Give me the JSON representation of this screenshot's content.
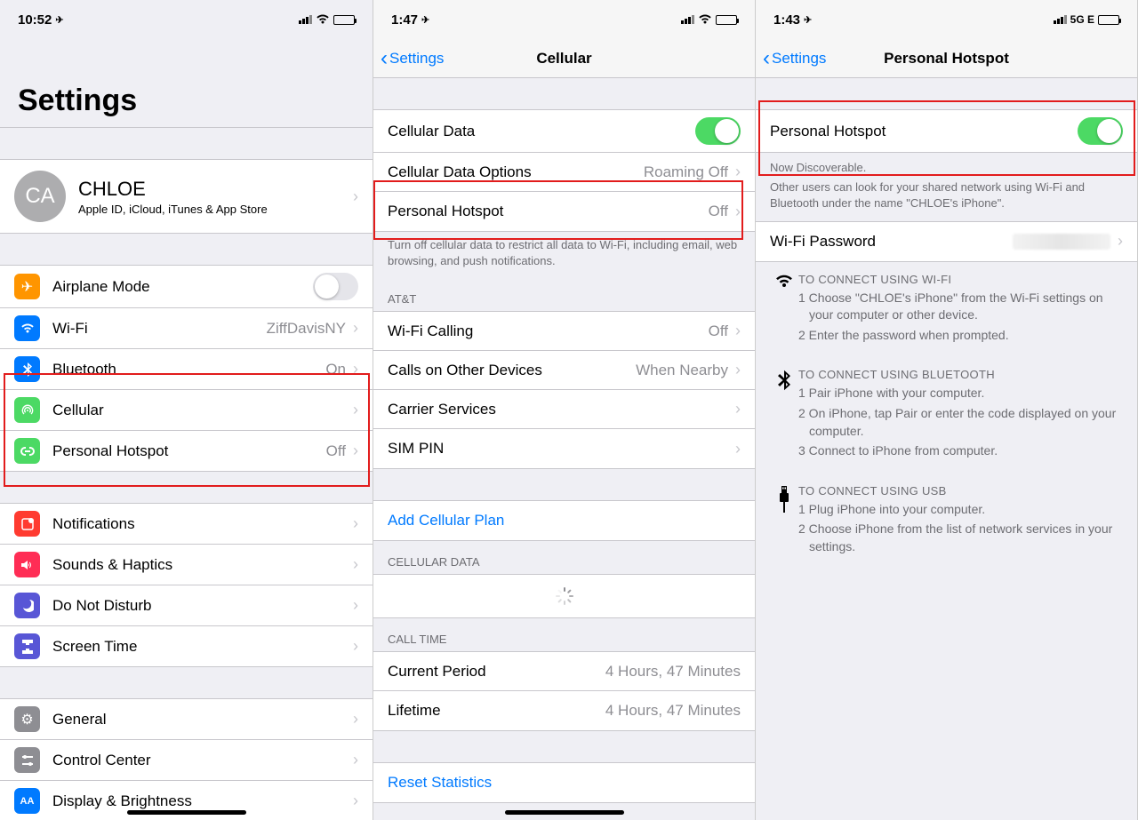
{
  "panel1": {
    "status_time": "10:52",
    "location_arrow": "➤",
    "title": "Settings",
    "profile": {
      "initials": "CA",
      "name": "CHLOE",
      "sub": "Apple ID, iCloud, iTunes & App Store"
    },
    "rows": {
      "airplane": {
        "label": "Airplane Mode"
      },
      "wifi": {
        "label": "Wi-Fi",
        "detail": "ZiffDavisNY"
      },
      "bluetooth": {
        "label": "Bluetooth",
        "detail": "On"
      },
      "cellular": {
        "label": "Cellular"
      },
      "hotspot": {
        "label": "Personal Hotspot",
        "detail": "Off"
      },
      "notifications": {
        "label": "Notifications"
      },
      "sounds": {
        "label": "Sounds & Haptics"
      },
      "dnd": {
        "label": "Do Not Disturb"
      },
      "screentime": {
        "label": "Screen Time"
      },
      "general": {
        "label": "General"
      },
      "controlcenter": {
        "label": "Control Center"
      },
      "display": {
        "label": "Display & Brightness"
      }
    }
  },
  "panel2": {
    "status_time": "1:47",
    "back": "Settings",
    "title": "Cellular",
    "rows": {
      "cell_data": {
        "label": "Cellular Data"
      },
      "cell_opts": {
        "label": "Cellular Data Options",
        "detail": "Roaming Off"
      },
      "hotspot": {
        "label": "Personal Hotspot",
        "detail": "Off"
      }
    },
    "footer1": "Turn off cellular data to restrict all data to Wi-Fi, including email, web browsing, and push notifications.",
    "header_att": "AT&T",
    "rows_att": {
      "wificall": {
        "label": "Wi-Fi Calling",
        "detail": "Off"
      },
      "othdev": {
        "label": "Calls on Other Devices",
        "detail": "When Nearby"
      },
      "carrier": {
        "label": "Carrier Services"
      },
      "simpin": {
        "label": "SIM PIN"
      }
    },
    "add_plan": "Add Cellular Plan",
    "header_cd": "CELLULAR DATA",
    "header_ct": "CALL TIME",
    "rows_ct": {
      "current": {
        "label": "Current Period",
        "detail": "4 Hours, 47 Minutes"
      },
      "lifetime": {
        "label": "Lifetime",
        "detail": "4 Hours, 47 Minutes"
      }
    },
    "reset": "Reset Statistics"
  },
  "panel3": {
    "status_time": "1:43",
    "status_net": "5G E",
    "back": "Settings",
    "title": "Personal Hotspot",
    "toggle_label": "Personal Hotspot",
    "discover": "Now Discoverable.",
    "discover_sub": "Other users can look for your shared network using Wi-Fi and Bluetooth under the name \"CHLOE's iPhone\".",
    "wifi_pw_label": "Wi-Fi Password",
    "instr": {
      "wifi": {
        "title": "TO CONNECT USING WI-FI",
        "steps": [
          "1 Choose \"CHLOE's iPhone\" from the Wi-Fi settings on your computer or other device.",
          "2 Enter the password when prompted."
        ]
      },
      "bt": {
        "title": "TO CONNECT USING BLUETOOTH",
        "steps": [
          "1 Pair iPhone with your computer.",
          "2 On iPhone, tap Pair or enter the code displayed on your computer.",
          "3 Connect to iPhone from computer."
        ]
      },
      "usb": {
        "title": "TO CONNECT USING USB",
        "steps": [
          "1 Plug iPhone into your computer.",
          "2 Choose iPhone from the list of network services in your settings."
        ]
      }
    }
  }
}
